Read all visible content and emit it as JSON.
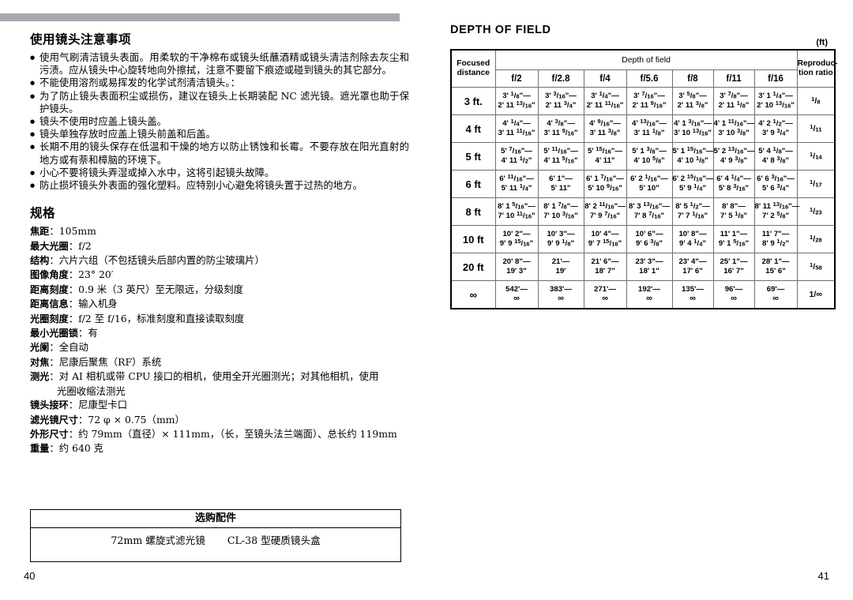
{
  "left": {
    "heading_cautions": "使用镜头注意事项",
    "cautions": [
      "使用气刷清洁镜头表面。用柔软的干净棉布或镜头纸蘸酒精或镜头清洁剂除去灰尘和污渍。应从镜头中心旋转地向外擦拭，注意不要留下痕迹或碰到镜头的其它部分。",
      "不能使用溶剂或易挥发的化学试剂清洁镜头。：",
      "为了防止镜头表面积尘或损伤，建议在镜头上长期装配 NC 滤光镜。遮光罩也助于保护镜头。",
      "镜头不使用时应盖上镜头盖。",
      "镜头单独存放时应盖上镜头前盖和后盖。",
      "长期不用的镜头保存在低温和干燥的地方以防止锈蚀和长霉。不要存放在阳光直射的地方或有萘和樟脑的环境下。",
      "小心不要将镜头弄湿或掉入水中，这将引起镜头故障。",
      "防止损坏镜头外表面的强化塑料。应特别小心避免将镜头置于过热的地方。"
    ],
    "heading_spec": "规格",
    "specs": [
      {
        "key": "焦距",
        "value": "：105mm"
      },
      {
        "key": "最大光圈",
        "value": "：f/2"
      },
      {
        "key": "结构",
        "value": "：六片六组（不包括镜头后部内置的防尘玻璃片）"
      },
      {
        "key": "图像角度",
        "value": "：23°  20′"
      },
      {
        "key": "距离刻度",
        "value": "：0.9 米（3 英尺）至无限远，分级刻度"
      },
      {
        "key": "距离信息",
        "value": "：输入机身"
      },
      {
        "key": "光圈刻度",
        "value": "：f/2 至 f/16，标准刻度和直接读取刻度"
      },
      {
        "key": "最小光圈锁",
        "value": "：有"
      },
      {
        "key": "光阑",
        "value": "：全自动"
      },
      {
        "key": "对焦",
        "value": "：尼康后聚焦（RF）系统"
      },
      {
        "key": "测光",
        "value": "：对 AI 相机或带 CPU 接口的相机，使用全开光圈测光；对其他相机，使用"
      },
      {
        "key": "",
        "value": "光圈收缩法测光",
        "continuation": true
      },
      {
        "key": "镜头接环",
        "value": "：尼康型卡口"
      },
      {
        "key": "滤光镜尺寸",
        "value": "：72 φ × 0.75（mm）"
      },
      {
        "key": "外形尺寸",
        "value": "：约 79mm（直径）× 111mm，（长，至镜头法兰端面）、总长约 119mm"
      },
      {
        "key": "重量",
        "value": "：约 640 克"
      }
    ],
    "accessories": {
      "title": "选购配件",
      "item1": "72mm 螺旋式滤光镜",
      "item2": "CL-38 型硬质镜头盒"
    },
    "page_number": "40"
  },
  "right": {
    "title": "DEPTH OF FIELD",
    "unit": "(ft)",
    "page_number": "41",
    "table": {
      "col_focused": "Focused\ndistance",
      "col_focused_l1": "Focused",
      "col_focused_l2": "distance",
      "col_group": "Depth of field",
      "col_ratio_l1": "Reproduc-",
      "col_ratio_l2": "tion ratio",
      "apertures": [
        "f/2",
        "f/2.8",
        "f/4",
        "f/5.6",
        "f/8",
        "f/11",
        "f/16"
      ]
    }
  },
  "chart_data": {
    "type": "table",
    "title": "DEPTH OF FIELD",
    "unit": "ft",
    "columns": [
      "Focused distance",
      "f/2",
      "f/2.8",
      "f/4",
      "f/5.6",
      "f/8",
      "f/11",
      "f/16",
      "Reproduction ratio"
    ],
    "rows": [
      {
        "distance": "3 ft.",
        "near_far": [
          [
            "3' 1/8\"",
            "2' 11 13/16\""
          ],
          [
            "3' 3/16\"",
            "2' 11 3/4\""
          ],
          [
            "3' 1/4\"",
            "2' 11 11/16\""
          ],
          [
            "3' 7/16\"",
            "2' 11 9/16\""
          ],
          [
            "3' 5/8\"",
            "2' 11 3/8\""
          ],
          [
            "3' 7/8\"",
            "2' 11 1/8\""
          ],
          [
            "3' 1 1/4\"",
            "2' 10 13/16\""
          ]
        ],
        "ratio": "1/8"
      },
      {
        "distance": "4 ft",
        "near_far": [
          [
            "4' 1/4\"",
            "3' 11 11/16\""
          ],
          [
            "4' 3/8\"",
            "3' 11 9/16\""
          ],
          [
            "4' 9/16\"",
            "3' 11 3/8\""
          ],
          [
            "4' 13/16\"",
            "3' 11 1/8\""
          ],
          [
            "4' 1 3/16\"",
            "3' 10 13/16\""
          ],
          [
            "4' 1 11/16\"",
            "3' 10 3/8\""
          ],
          [
            "4' 2 1/2\"",
            "3' 9 3/4\""
          ]
        ],
        "ratio": "1/11"
      },
      {
        "distance": "5 ft",
        "near_far": [
          [
            "5' 7/16\"",
            "4' 11 1/2\""
          ],
          [
            "5' 11/16\"",
            "4' 11 5/16\""
          ],
          [
            "5' 15/16\"",
            "4' 11\""
          ],
          [
            "5' 1 3/8\"",
            "4' 10 5/8\""
          ],
          [
            "5' 1 15/16\"",
            "4' 10 1/8\""
          ],
          [
            "5' 2 13/16\"",
            "4' 9 3/8\""
          ],
          [
            "5' 4 1/8\"",
            "4' 8 3/8\""
          ]
        ],
        "ratio": "1/14"
      },
      {
        "distance": "6 ft",
        "near_far": [
          [
            "6' 11/16\"",
            "5' 11 1/4\""
          ],
          [
            "6' 1\"",
            "5' 11\""
          ],
          [
            "6' 1 7/16\"",
            "5' 10 9/16\""
          ],
          [
            "6' 2 1/16\"",
            "5' 10\""
          ],
          [
            "6' 2 15/16\"",
            "5' 9 1/4\""
          ],
          [
            "6' 4 1/4\"",
            "5' 8 3/16\""
          ],
          [
            "6' 6 3/16\"",
            "5' 6 3/4\""
          ]
        ],
        "ratio": "1/17"
      },
      {
        "distance": "8 ft",
        "near_far": [
          [
            "8' 1 5/16\"",
            "7' 10 11/16\""
          ],
          [
            "8' 1 7/8\"",
            "7' 10 3/16\""
          ],
          [
            "8' 2 11/16\"",
            "7' 9 7/16\""
          ],
          [
            "8' 3 13/16\"",
            "7' 8 7/16\""
          ],
          [
            "8' 5 1/2\"",
            "7' 7 1/16\""
          ],
          [
            "8' 8\"",
            "7' 5 1/8\""
          ],
          [
            "8' 11 13/16\"",
            "7' 2 5/8\""
          ]
        ],
        "ratio": "1/23"
      },
      {
        "distance": "10 ft",
        "near_far": [
          [
            "10' 2\"",
            "9' 9 15/16\""
          ],
          [
            "10' 3\"",
            "9' 9 1/8\""
          ],
          [
            "10' 4\"",
            "9' 7 15/16\""
          ],
          [
            "10' 6\"",
            "9' 6 3/8\""
          ],
          [
            "10' 8\"",
            "9' 4 1/4\""
          ],
          [
            "11' 1\"",
            "9' 1 5/16\""
          ],
          [
            "11' 7\"",
            "8' 9 1/2\""
          ]
        ],
        "ratio": "1/28"
      },
      {
        "distance": "20 ft",
        "near_far": [
          [
            "20' 8\"",
            "19' 3\""
          ],
          [
            "21'",
            "19'"
          ],
          [
            "21' 6\"",
            "18' 7\""
          ],
          [
            "23' 3\"",
            "18' 1\""
          ],
          [
            "23' 4\"",
            "17' 6\""
          ],
          [
            "25' 1\"",
            "16' 7\""
          ],
          [
            "28' 1\"",
            "15' 6\""
          ]
        ],
        "ratio": "1/58"
      },
      {
        "distance": "∞",
        "near_far": [
          [
            "542'",
            "∞"
          ],
          [
            "383'",
            "∞"
          ],
          [
            "271'",
            "∞"
          ],
          [
            "192'",
            "∞"
          ],
          [
            "135'",
            "∞"
          ],
          [
            "96'",
            "∞"
          ],
          [
            "69'",
            "∞"
          ]
        ],
        "ratio": "1/∞"
      }
    ]
  }
}
